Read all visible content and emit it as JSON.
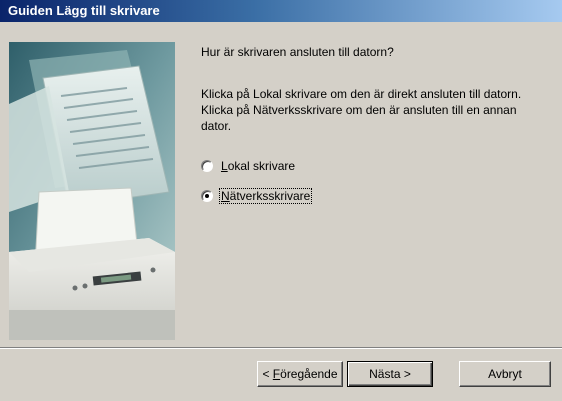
{
  "window": {
    "title": "Guiden Lägg till skrivare"
  },
  "page": {
    "question": "Hur är skrivaren ansluten till datorn?",
    "description": "Klicka på Lokal skrivare om den är direkt ansluten till datorn. Klicka på Nätverksskrivare om den är ansluten till en annan dator."
  },
  "options": [
    {
      "label": "Lokal skrivare",
      "accelerator": "L",
      "selected": false
    },
    {
      "label": "Nätverksskrivare",
      "accelerator": "N",
      "selected": true
    }
  ],
  "buttons": {
    "back": "< Föregående",
    "next": "Nästa >",
    "cancel": "Avbryt"
  },
  "colors": {
    "dialog_face": "#d4d0c8",
    "titlebar_start": "#0a246a",
    "titlebar_end": "#a6caf0",
    "title_text": "#ffffff"
  },
  "icons": {
    "illustration": "printer-with-documents-illustration"
  }
}
